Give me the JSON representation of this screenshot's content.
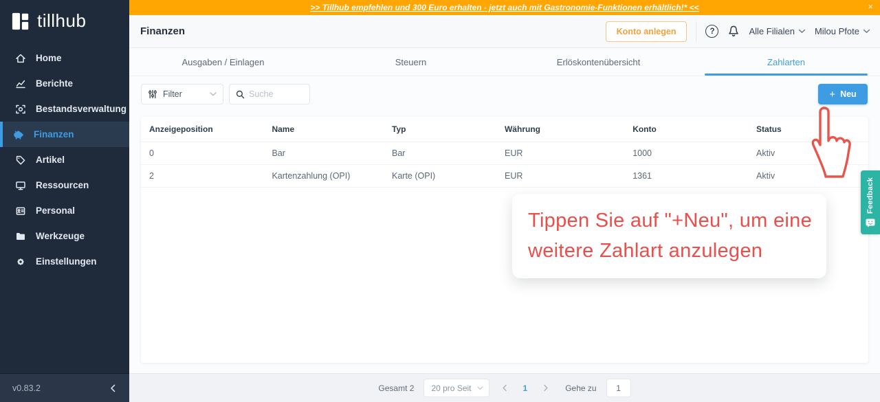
{
  "banner": {
    "text": ">> Tillhub empfehlen und 300 Euro erhalten - jetzt auch mit Gastronomie-Funktionen erhältlich!* <<",
    "close_icon": "×"
  },
  "sidebar": {
    "logo_text": "tillhub",
    "items": [
      {
        "label": "Home"
      },
      {
        "label": "Berichte"
      },
      {
        "label": "Bestandsverwaltung"
      },
      {
        "label": "Finanzen"
      },
      {
        "label": "Artikel"
      },
      {
        "label": "Ressourcen"
      },
      {
        "label": "Personal"
      },
      {
        "label": "Werkzeuge"
      },
      {
        "label": "Einstellungen"
      }
    ],
    "active_item": "Finanzen",
    "version": "v0.83.2"
  },
  "header": {
    "title": "Finanzen",
    "konto_button": "Konto anlegen",
    "help_icon": "?",
    "branch_selector": "Alle Filialen",
    "user_menu": "Milou Pfote"
  },
  "tabs": {
    "items": [
      {
        "label": "Ausgaben / Einlagen"
      },
      {
        "label": "Steuern"
      },
      {
        "label": "Erlöskontenübersicht"
      },
      {
        "label": "Zahlarten"
      }
    ],
    "active": "Zahlarten"
  },
  "toolbar": {
    "filter_label": "Filter",
    "search_placeholder": "Suche",
    "plus_icon": "+",
    "new_button_label": "Neu"
  },
  "table": {
    "columns": [
      "Anzeigeposition",
      "Name",
      "Typ",
      "Währung",
      "Konto",
      "Status"
    ],
    "rows": [
      [
        "0",
        "Bar",
        "Bar",
        "EUR",
        "1000",
        "Aktiv"
      ],
      [
        "2",
        "Kartenzahlung (OPI)",
        "Karte (OPI)",
        "EUR",
        "1361",
        "Aktiv"
      ]
    ]
  },
  "annotation": {
    "line1": "Tippen Sie auf \"+Neu\", um eine",
    "line2": "weitere Zahlart anzulegen"
  },
  "feedback_tab": {
    "label": "Feedback"
  },
  "pagination": {
    "total": "Gesamt 2",
    "page_size": "20 pro Seit",
    "current_page": "1",
    "goto_label": "Gehe zu",
    "goto_value": "1"
  },
  "colors": {
    "accent_blue": "#3d9ce2",
    "banner_orange": "#ffa602",
    "button_orange": "#f2a13c",
    "annotation_red": "#e8554d",
    "feedback_teal": "#2cb4a4",
    "sidebar_navy": "#1f2a3a"
  }
}
